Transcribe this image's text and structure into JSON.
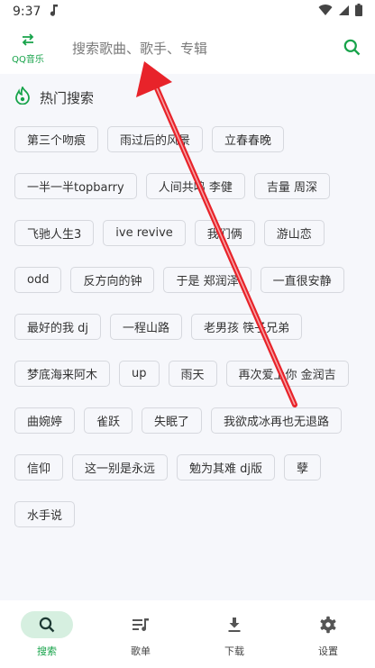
{
  "status_bar": {
    "time": "9:37"
  },
  "top_bar": {
    "brand_label": "QQ音乐",
    "search_placeholder": "搜索歌曲、歌手、专辑"
  },
  "hot_search": {
    "title": "热门搜索",
    "rows": [
      [
        "第三个吻痕",
        "雨过后的风景",
        "立春春晚"
      ],
      [
        "一半一半topbarry",
        "人间共鸣 李健",
        "吉量 周深"
      ],
      [
        "飞驰人生3",
        "ive revive",
        "我们俩",
        "游山恋"
      ],
      [
        "odd",
        "反方向的钟",
        "于是 郑润泽",
        "一直很安静"
      ],
      [
        "最好的我 dj",
        "一程山路",
        "老男孩 筷子兄弟"
      ],
      [
        "梦底海来阿木",
        "up",
        "雨天",
        "再次爱上你 金润吉"
      ],
      [
        "曲婉婷",
        "雀跃",
        "失眠了",
        "我欲成冰再也无退路"
      ],
      [
        "信仰",
        "这一别是永远",
        "勉为其难 dj版",
        "孽"
      ],
      [
        "水手说"
      ]
    ]
  },
  "bottom_nav": [
    {
      "label": "搜索",
      "icon": "search-icon",
      "active": true
    },
    {
      "label": "歌单",
      "icon": "playlist-icon",
      "active": false
    },
    {
      "label": "下载",
      "icon": "download-icon",
      "active": false
    },
    {
      "label": "设置",
      "icon": "gear-icon",
      "active": false
    }
  ],
  "colors": {
    "accent": "#17a34a",
    "arrow": "#e8232a"
  }
}
